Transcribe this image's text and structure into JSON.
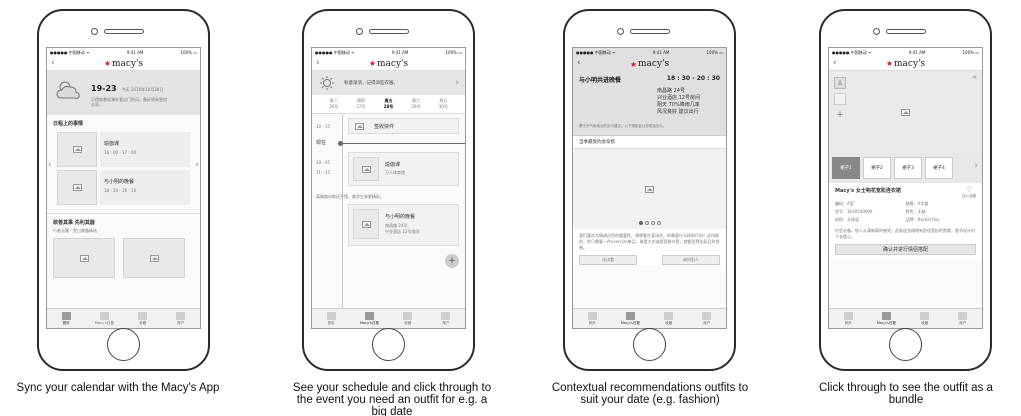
{
  "status": {
    "carrier": "●●●●● 中国移动 ᯤ",
    "time": "9:41 AM",
    "battery": "100% ▭"
  },
  "logo_text": "macy's",
  "tabs": [
    "首页",
    "Macy's日报",
    "收藏",
    "账户"
  ],
  "screen1": {
    "date_big": "19-23",
    "date_small": "今天 2016年10月28日",
    "weather_note": "记得穿着轻薄外套出门防风，备好雨具更加从容。",
    "section1_title": "日程上的事情",
    "events": [
      {
        "title": "瑜伽课",
        "time": "16 : 00 - 17 : 00"
      },
      {
        "title": "与小明的晚餐",
        "time": "18 : 30 - 20 : 30"
      }
    ],
    "section2_title": "欲善其事 先利其器",
    "section2_sub": "行者无疆 - 登山装备精选"
  },
  "screen2": {
    "weather_note": "秋意渐浓，记得添些衣服。",
    "days": [
      {
        "name": "周三",
        "date": "26号"
      },
      {
        "name": "周四",
        "date": "27号"
      },
      {
        "name": "周五",
        "date": "28号"
      },
      {
        "name": "周六",
        "date": "29号"
      },
      {
        "name": "周日",
        "date": "30号"
      }
    ],
    "item1": {
      "time": "10 : 15",
      "title": "签收快件"
    },
    "now_label": "现在",
    "item2": {
      "time1": "10 : 45",
      "time2": "11 : 15",
      "title": "瑜伽课",
      "sub": "万人体育馆"
    },
    "note": "离瑜伽训练还不错，着学生来更精彩。",
    "item3": {
      "title": "与小明的晚餐",
      "addr1": "南昌路 24号",
      "addr2": "兴业酒店 12号房间"
    },
    "fab": "+"
  },
  "screen3": {
    "title": "与小明共进晚餐",
    "time": "18 : 30 - 20 : 30",
    "addr1": "南昌路 24号",
    "addr2": "兴业酒店 12号房间",
    "weather": "阴天 70%降雨几率",
    "wind": "风况良好 建议出行",
    "note": "基于天气和地点的出行建议，以下搭配会让你更加出众。",
    "section": "当季最受约会穿搭",
    "desc": "我们喜欢为情调出色的重要性。想想看在某场合，你需要什么样的打扮？这叫做的，你只需要一件oversize单品，像是大衣或是西装外套，就能显得出彩且时尚感。",
    "btn_left": "试试看",
    "btn_right": "询问别人"
  },
  "screen4": {
    "sizes": [
      "裙子1",
      "裙子2",
      "裙子3",
      "裙子4"
    ],
    "product": "Macy's 女士钩花宽松连衣裙",
    "fav": "加入收藏",
    "details": [
      [
        "编码：A型",
        "规格：A字裙"
      ],
      [
        "货号：1630509690",
        "颜色：无袖"
      ],
      [
        "材质：羊绒混",
        "品牌：Rachel Roy"
      ]
    ],
    "desc": "约会必备。链人从满新颖的感觉，此款连衣裙拥有舒适宽松的剪裁，细节设计对于长楼心。",
    "button": "确认并进行情侣搭配"
  },
  "captions": [
    "Sync your calendar with the Macy's App",
    "See your schedule and click through to the event you need an outfit for e.g. a big date",
    "Contextual recommendations outfits to suit your date (e.g. fashion)",
    "Click through to see the outfit as a bundle"
  ]
}
